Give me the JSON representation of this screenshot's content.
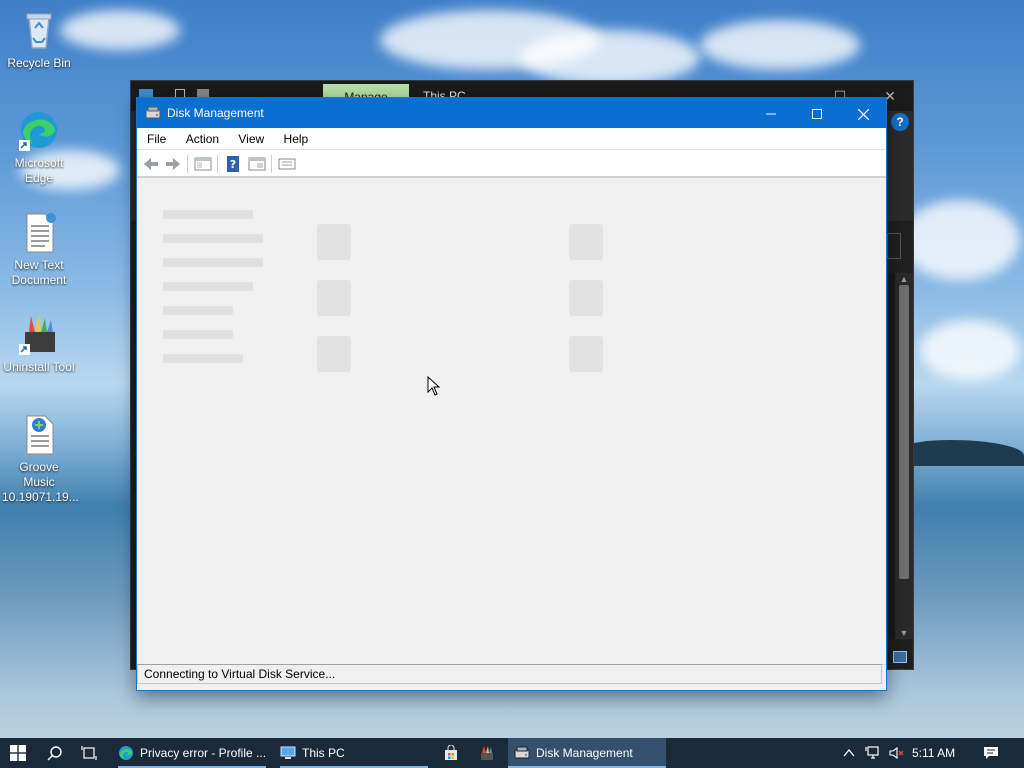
{
  "desktop": {
    "icons": [
      {
        "label": "Recycle Bin",
        "icon": "recycle-bin-icon"
      },
      {
        "label": "Microsoft Edge",
        "icon": "edge-icon"
      },
      {
        "label": "New Text Document",
        "icon": "text-document-icon"
      },
      {
        "label": "Uninstall Tool",
        "icon": "uninstall-tool-icon"
      },
      {
        "label": "Groove Music 10.19071.19...",
        "icon": "groove-music-file-icon"
      }
    ]
  },
  "explorer": {
    "manage_tab": "Manage",
    "title": "This PC"
  },
  "disk_management": {
    "title": "Disk Management",
    "menu": [
      "File",
      "Action",
      "View",
      "Help"
    ],
    "status": "Connecting to Virtual Disk Service..."
  },
  "taskbar": {
    "apps": [
      {
        "label": "Privacy error - Profile ...",
        "icon": "edge-icon"
      },
      {
        "label": "This PC",
        "icon": "this-pc-icon"
      },
      {
        "label": "Disk Management",
        "icon": "disk-management-icon"
      }
    ],
    "clock": "5:11 AM"
  },
  "colors": {
    "accent": "#0a6fd1",
    "taskbar": "#1b2a3a",
    "manage_tab": "#b4e0a4"
  }
}
